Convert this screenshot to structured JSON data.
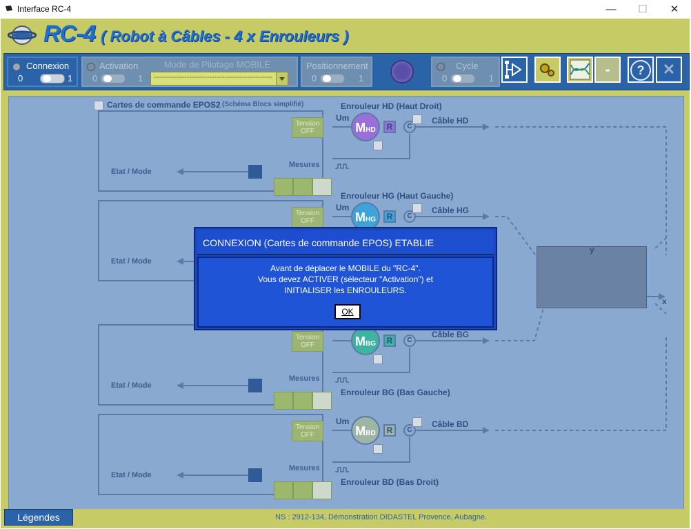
{
  "window": {
    "title": "Interface RC-4",
    "minimize": "—",
    "maximize": "☐",
    "close": "✕"
  },
  "header": {
    "brand": "RC-4",
    "subtitle": "( Robot à Câbles - 4 x Enrouleurs )"
  },
  "toolbar": {
    "connexion": {
      "label": "Connexion",
      "off": "0",
      "on": "1"
    },
    "activation": {
      "label": "Activation",
      "off": "0",
      "on": "1"
    },
    "mode": {
      "label": "Mode de Pilotage MOBILE",
      "value": "-----------------------------------------------"
    },
    "positionnement": {
      "label": "Positionnement",
      "off": "0",
      "on": "1"
    },
    "cycle": {
      "label": "Cycle",
      "off": "0",
      "on": "1"
    },
    "help": "?",
    "quit": "✕",
    "minus": "-"
  },
  "diagram": {
    "section_title": "Cartes de commande EPOS2",
    "section_sub": "(Schéma Blocs simplifié)",
    "um": "Um",
    "mesures": "Mesures",
    "etat_mode": "Etat / Mode",
    "tension": "Tension",
    "tension_state": "OFF",
    "r": "R",
    "c": "C",
    "x_axis": "x",
    "y_axis": "y",
    "motors": [
      {
        "id": "HD",
        "m": "M",
        "sub": "HD",
        "title": "Enrouleur HD (Haut Droit)",
        "cable": "Câble HD",
        "color": "#9b6fd8"
      },
      {
        "id": "HG",
        "m": "M",
        "sub": "HG",
        "title": "Enrouleur HG (Haut Gauche)",
        "cable": "Câble HG",
        "color": "#3ea3d8"
      },
      {
        "id": "BG",
        "m": "M",
        "sub": "BG",
        "title": "Enrouleur BG (Bas Gauche)",
        "cable": "Câble BG",
        "color": "#3fb3a1"
      },
      {
        "id": "BD",
        "m": "M",
        "sub": "BD",
        "title": "Enrouleur BD (Bas Droit)",
        "cable": "Câble BD",
        "color": "#9eb5a6"
      }
    ]
  },
  "dialog": {
    "title": "CONNEXION (Cartes de commande EPOS) ETABLIE",
    "line1": "Avant de déplacer le MOBILE du \"RC-4\".",
    "line2": "Vous devez ACTIVER (sélecteur \"Activation\") et",
    "line3": "INITIALISER les ENROULEURS.",
    "ok": "OK"
  },
  "footer": {
    "legendes": "Légendes",
    "note": "NS : 2912-134, Démonstration DIDASTEL Provence, Aubagne."
  },
  "colors": {
    "toolbar": "#2b63a8",
    "olive": "#c7cb66",
    "canvas": "#8aa9d1",
    "dialog": "#1947c3"
  }
}
